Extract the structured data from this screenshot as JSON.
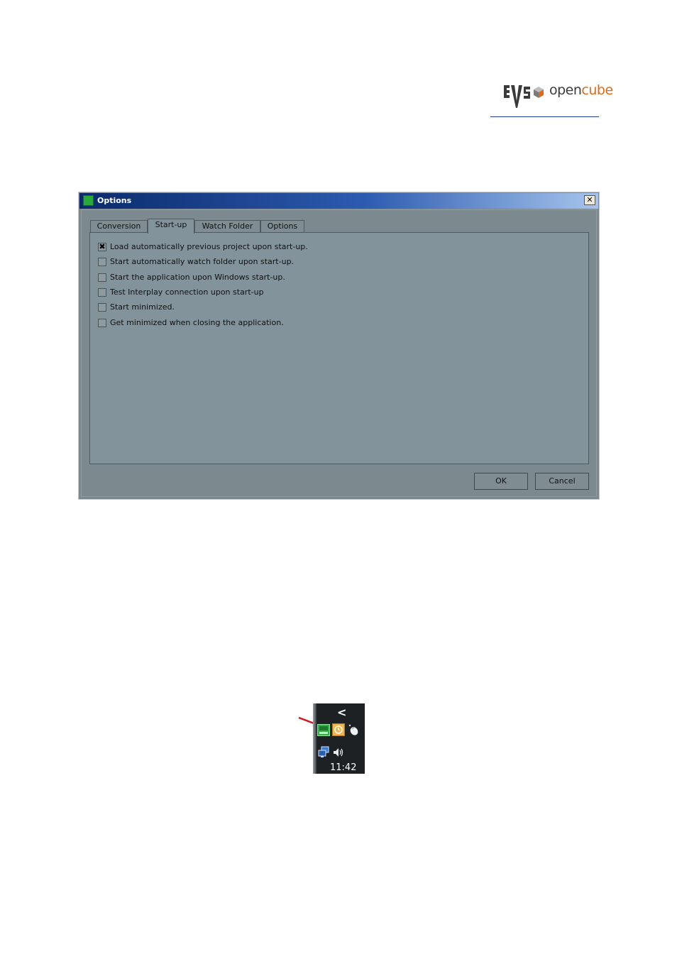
{
  "logo": {
    "part1": "open",
    "part2": "cube",
    "colors": {
      "dark": "#3b3b3b",
      "orange": "#e06a1b"
    }
  },
  "dialog": {
    "title": "Options",
    "close_glyph": "✕",
    "tabs": [
      {
        "label": "Conversion",
        "active": false
      },
      {
        "label": "Start-up",
        "active": true
      },
      {
        "label": "Watch Folder",
        "active": false
      },
      {
        "label": "Options",
        "active": false
      }
    ],
    "options": [
      {
        "label": "Load automatically previous project upon start-up.",
        "checked": true,
        "mark": "✖"
      },
      {
        "label": "Start automatically watch folder upon start-up.",
        "checked": false,
        "mark": ""
      },
      {
        "label": "Start the application upon Windows start-up.",
        "checked": false,
        "mark": ""
      },
      {
        "label": "Test Interplay connection upon start-up",
        "checked": false,
        "mark": ""
      },
      {
        "label": "Start minimized.",
        "checked": false,
        "mark": ""
      },
      {
        "label": "Get minimized when closing the application.",
        "checked": false,
        "mark": ""
      }
    ],
    "ok_label": "OK",
    "cancel_label": "Cancel"
  },
  "tray": {
    "chevron": "<",
    "time": "11:42",
    "icons": [
      "app-tray-icon",
      "clock-icon",
      "mouse-icon",
      "network-icon",
      "volume-icon"
    ]
  }
}
